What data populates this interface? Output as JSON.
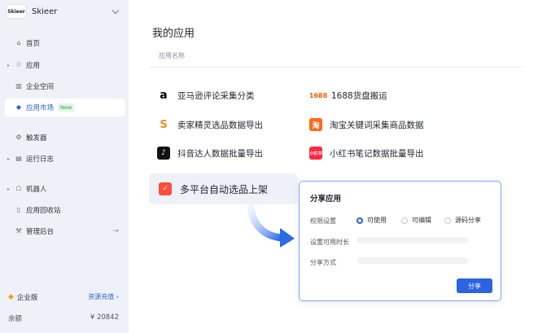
{
  "brand": {
    "logo_text": "Skieer",
    "name": "Skieer"
  },
  "sidebar": {
    "items": [
      {
        "label": "首页",
        "icon": "home-icon"
      },
      {
        "label": "应用",
        "icon": "grid-icon"
      },
      {
        "label": "企业空间",
        "icon": "building-icon"
      },
      {
        "label": "应用市场",
        "icon": "store-icon",
        "badge": "New"
      },
      {
        "label": "触发器",
        "icon": "trigger-icon"
      },
      {
        "label": "运行日志",
        "icon": "log-icon"
      },
      {
        "label": "机器人",
        "icon": "robot-icon"
      },
      {
        "label": "应用回收站",
        "icon": "trash-icon"
      },
      {
        "label": "管理后台",
        "icon": "settings-icon"
      }
    ]
  },
  "enterprise": {
    "edition": "企业版",
    "recharge": "资源充值",
    "balance_label": "余额",
    "balance_value": "¥ 20842"
  },
  "main": {
    "title": "我的应用",
    "column_label": "应用名称",
    "apps": [
      {
        "name": "亚马逊评论采集分类",
        "icon_text": "a",
        "icon": "amazon-icon"
      },
      {
        "name": "1688货盘搬运",
        "icon_text": "1688",
        "icon": "1688-icon"
      },
      {
        "name": "卖家精灵选品数据导出",
        "icon_text": "S",
        "icon": "seller-sprite-icon"
      },
      {
        "name": "淘宝关键词采集商品数据",
        "icon_text": "淘",
        "icon": "taobao-icon"
      },
      {
        "name": "抖音达人数据批量导出",
        "icon_text": "♪",
        "icon": "douyin-icon"
      },
      {
        "name": "小红书笔记数据批量导出",
        "icon_text": "小红书",
        "icon": "xiaohongshu-icon"
      }
    ],
    "highlighted_app": {
      "name": "多平台自动选品上架",
      "icon": "multi-platform-icon"
    }
  },
  "share_panel": {
    "title": "分享应用",
    "permission_label": "权限设置",
    "options": [
      "可使用",
      "可编辑",
      "源码分享"
    ],
    "selected_option": "可使用",
    "duration_label": "设置可用时长",
    "method_label": "分享方式",
    "button": "分享"
  },
  "colors": {
    "accent": "#2b63e0",
    "sidebar_bg": "#eef2f8",
    "panel_border": "#7fa6ec"
  }
}
